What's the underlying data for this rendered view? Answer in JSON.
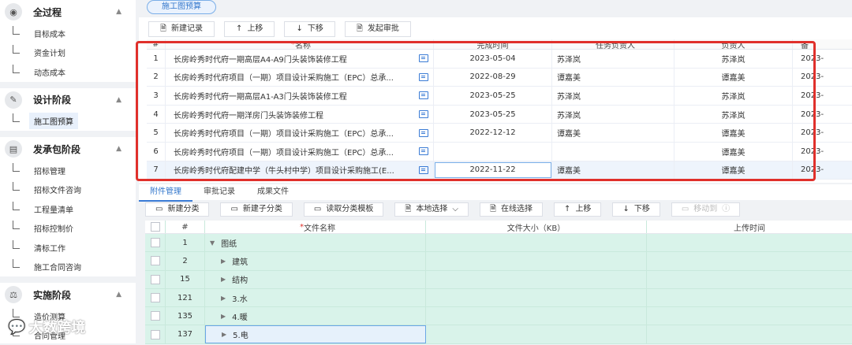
{
  "sidebar": {
    "groups": [
      {
        "label": "全过程",
        "icon": "shield-icon",
        "items": [
          "目标成本",
          "资金计划",
          "动态成本"
        ]
      },
      {
        "label": "设计阶段",
        "icon": "design-icon",
        "items": [
          "施工图预算"
        ]
      },
      {
        "label": "发承包阶段",
        "icon": "contract-icon",
        "items": [
          "招标管理",
          "招标文件咨询",
          "工程量清单",
          "招标控制价",
          "清标工作",
          "施工合同咨询"
        ]
      },
      {
        "label": "实施阶段",
        "icon": "scale-icon",
        "items": [
          "造价测算",
          "合同管理"
        ]
      }
    ]
  },
  "top_tab": "施工图预算",
  "toolbar": {
    "new": "新建记录",
    "up": "上移",
    "down": "下移",
    "submit": "发起审批"
  },
  "table": {
    "headers": [
      "#",
      "名称",
      "完成时间",
      "任务负责人",
      "负责人",
      "备"
    ],
    "rows": [
      {
        "idx": "1",
        "name": "长房岭秀时代府一期高层A4-A9门头装饰装修工程",
        "date": "2023-05-04",
        "resp": "苏泽岚",
        "owner": "苏泽岚",
        "extra": "2023-"
      },
      {
        "idx": "2",
        "name": "长房岭秀时代府项目（一期）项目设计采购施工（EPC）总承...",
        "date": "2022-08-29",
        "resp": "谭嘉美",
        "owner": "谭嘉美",
        "extra": "2023-"
      },
      {
        "idx": "3",
        "name": "长房岭秀时代府一期高层A1-A3门头装饰装修工程",
        "date": "2023-05-25",
        "resp": "苏泽岚",
        "owner": "苏泽岚",
        "extra": "2023-"
      },
      {
        "idx": "4",
        "name": "长房岭秀时代府一期洋房门头装饰装修工程",
        "date": "2023-05-25",
        "resp": "苏泽岚",
        "owner": "苏泽岚",
        "extra": "2023-"
      },
      {
        "idx": "5",
        "name": "长房岭秀时代府项目（一期）项目设计采购施工（EPC）总承...",
        "date": "2022-12-12",
        "resp": "谭嘉美",
        "owner": "谭嘉美",
        "extra": "2023-"
      },
      {
        "idx": "6",
        "name": "长房岭秀时代府项目（一期）项目设计采购施工（EPC）总承...",
        "date": "",
        "resp": "",
        "owner": "谭嘉美",
        "extra": "2023-"
      },
      {
        "idx": "7",
        "name": "长房岭秀时代府配建中学（牛头村中学）项目设计采购施工(E...",
        "date": "2022-11-22",
        "resp": "谭嘉美",
        "owner": "谭嘉美",
        "extra": "2023-"
      }
    ]
  },
  "tabs2": [
    "附件管理",
    "审批记录",
    "成果文件"
  ],
  "toolbar2": {
    "new_cat": "新建分类",
    "new_sub": "新建子分类",
    "read_tpl": "读取分类模板",
    "local": "本地选择",
    "online": "在线选择",
    "up": "上移",
    "down": "下移",
    "move": "移动到"
  },
  "files": {
    "headers": [
      "#",
      "文件名称",
      "文件大小（KB）",
      "上传时间"
    ],
    "rows": [
      {
        "id": "1",
        "name": "图纸",
        "expanded": true,
        "level": 0
      },
      {
        "id": "2",
        "name": "建筑",
        "expanded": false,
        "level": 1
      },
      {
        "id": "15",
        "name": "结构",
        "expanded": false,
        "level": 1
      },
      {
        "id": "121",
        "name": "3.水",
        "expanded": false,
        "level": 1
      },
      {
        "id": "135",
        "name": "4.暖",
        "expanded": false,
        "level": 1
      },
      {
        "id": "137",
        "name": "5.电",
        "expanded": false,
        "level": 1
      }
    ]
  },
  "watermark": "大数跨境"
}
